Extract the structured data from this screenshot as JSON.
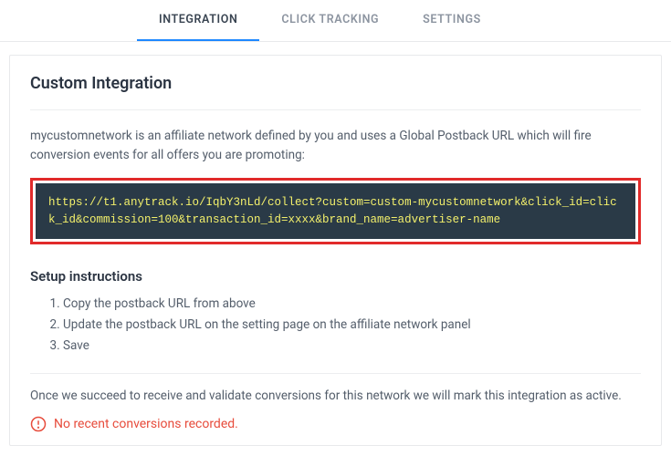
{
  "tabs": {
    "integration": "INTEGRATION",
    "click_tracking": "CLICK TRACKING",
    "settings": "SETTINGS"
  },
  "card": {
    "title": "Custom Integration",
    "description": "mycustomnetwork is an affiliate network defined by you and uses a Global Postback URL which will fire conversion events for all offers you are promoting:",
    "postback_url": "https://t1.anytrack.io/IqbY3nLd/collect?custom=custom-mycustomnetwork&click_id=click_id&commission=100&transaction_id=xxxx&brand_name=advertiser-name",
    "instructions_title": "Setup instructions",
    "instructions": [
      "Copy the postback URL from above",
      "Update the postback URL on the setting page on the affiliate network panel",
      "Save"
    ],
    "footer_note": "Once we succeed to receive and validate conversions for this network we will mark this integration as active.",
    "alert": "No recent conversions recorded."
  }
}
